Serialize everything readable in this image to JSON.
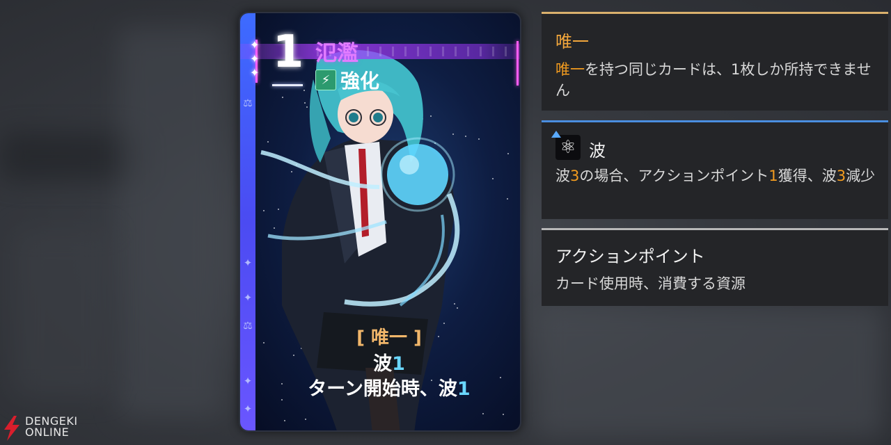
{
  "card": {
    "cost": "1",
    "name": "氾濫",
    "type_icon": "lightning-icon",
    "type_label": "強化",
    "keyword": "[ 唯一 ]",
    "effect_line1_prefix": "波",
    "effect_line1_value": "1",
    "effect_line2_prefix": "ターン開始時、波",
    "effect_line2_value": "1",
    "colors": {
      "name": "#e27cff",
      "keyword": "#f1b66a",
      "number": "#6ad7ff",
      "stripe": "#4b4bf2"
    }
  },
  "panels": {
    "unique": {
      "title": "唯一",
      "desc_highlight": "唯一",
      "desc_rest": "を持つ同じカードは、1枚しか所持できません",
      "accent": "#d9b06c"
    },
    "wave": {
      "icon": "atom-icon",
      "title": "波",
      "desc_part1": "波",
      "desc_num1": "3",
      "desc_part2": "の場合、アクションポイント",
      "desc_num2": "1",
      "desc_part3": "獲得、波",
      "desc_num3": "3",
      "desc_part4": "減少",
      "accent": "#4a8ee0"
    },
    "action_point": {
      "title": "アクションポイント",
      "desc": "カード使用時、消費する資源"
    }
  },
  "watermark": {
    "line1": "DENGEKI",
    "line2": "ONLINE"
  }
}
